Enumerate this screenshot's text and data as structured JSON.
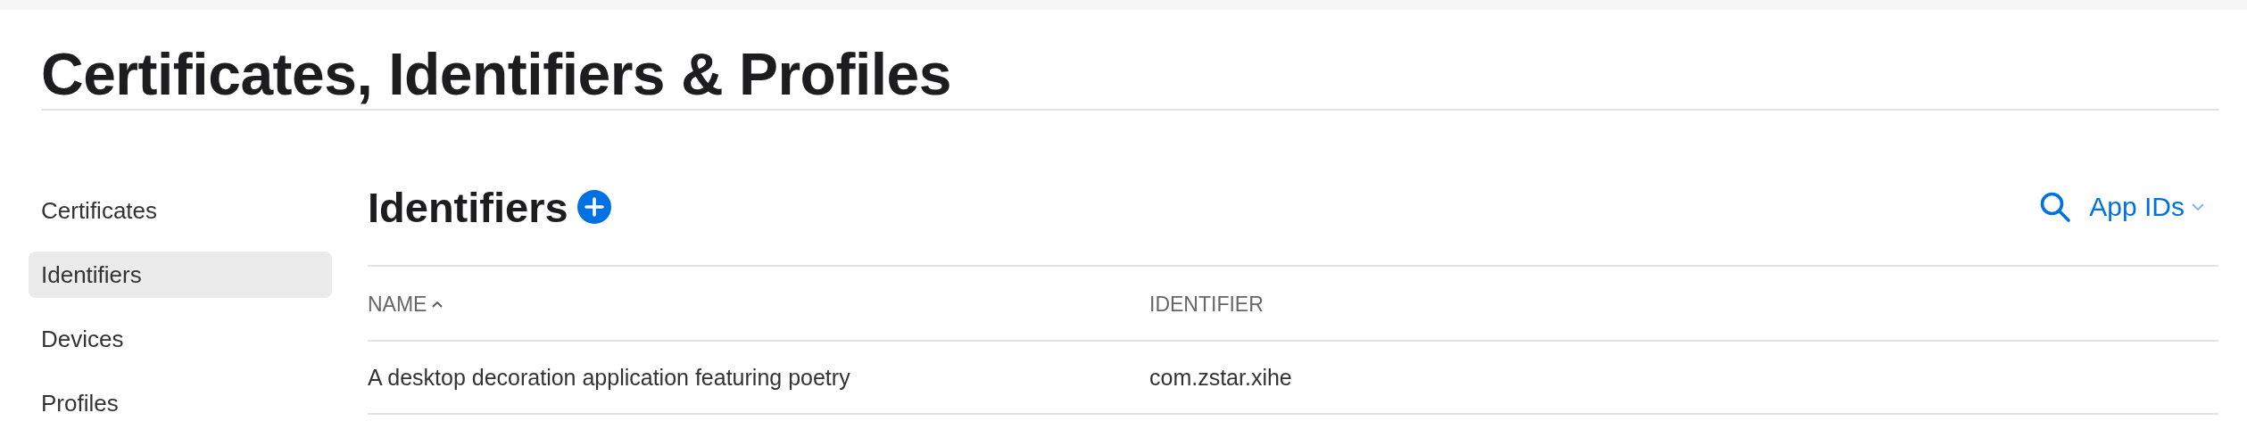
{
  "page": {
    "title": "Certificates, Identifiers & Profiles"
  },
  "sidebar": {
    "items": [
      {
        "label": "Certificates",
        "selected": false
      },
      {
        "label": "Identifiers",
        "selected": true
      },
      {
        "label": "Devices",
        "selected": false
      },
      {
        "label": "Profiles",
        "selected": false
      }
    ]
  },
  "section": {
    "title": "Identifiers",
    "filter": "App IDs"
  },
  "table": {
    "columns": [
      {
        "label": "NAME",
        "sorted": true
      },
      {
        "label": "IDENTIFIER",
        "sorted": false
      }
    ],
    "rows": [
      {
        "cells": [
          "A desktop decoration application featuring poetry",
          "com.zstar.xihe"
        ]
      }
    ]
  }
}
